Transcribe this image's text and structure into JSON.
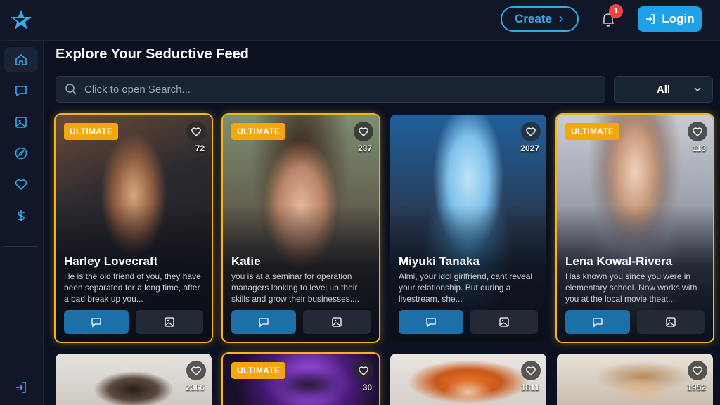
{
  "header": {
    "create_label": "Create",
    "notification_count": "1",
    "login_label": "Login"
  },
  "main": {
    "title": "Explore Your Seductive Feed",
    "search_placeholder": "Click to open Search...",
    "filter_value": "All"
  },
  "badge_label": "ULTIMATE",
  "cards": [
    {
      "name": "Harley Lovecraft",
      "likes": "72",
      "ultimate": true,
      "description": "He is the old friend of you, they have been separated for a long time, after a bad break up you..."
    },
    {
      "name": "Katie",
      "likes": "237",
      "ultimate": true,
      "description": "you is at a seminar for operation managers looking to level up their skills and grow their businesses...."
    },
    {
      "name": "Miyuki Tanaka",
      "likes": "2027",
      "ultimate": false,
      "description": "Almi, your idol girlfriend, cant reveal your relationship. But during a livestream, she..."
    },
    {
      "name": "Lena Kowal-Rivera",
      "likes": "113",
      "ultimate": true,
      "description": "Has known you since you were in elementary school. Now works with you at the local movie theat..."
    },
    {
      "name": "",
      "likes": "2366",
      "ultimate": false,
      "description": ""
    },
    {
      "name": "",
      "likes": "30",
      "ultimate": true,
      "description": ""
    },
    {
      "name": "",
      "likes": "1811",
      "ultimate": false,
      "description": ""
    },
    {
      "name": "",
      "likes": "1952",
      "ultimate": false,
      "description": ""
    }
  ],
  "colors": {
    "accent": "#1ea1e6",
    "ultimate": "#f5a60a",
    "background": "#0b1120"
  }
}
